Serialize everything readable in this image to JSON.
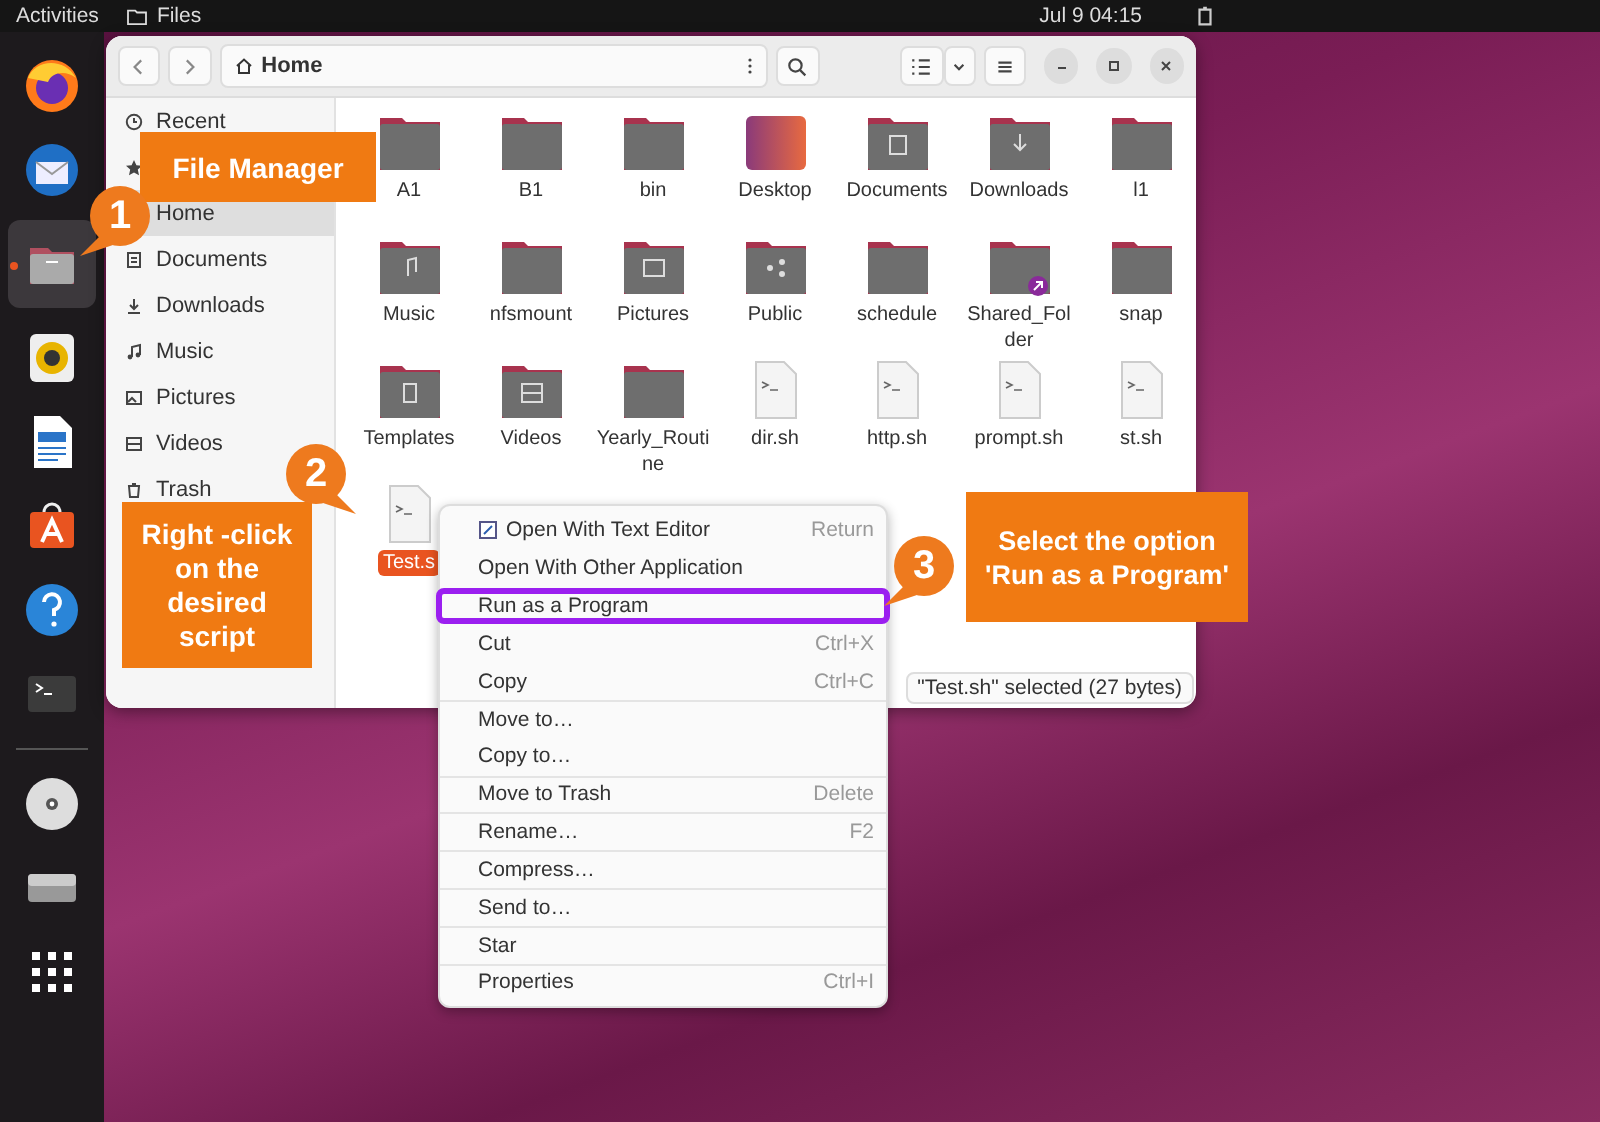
{
  "top_bar": {
    "activities": "Activities",
    "app_name": "Files",
    "clock": "Jul 9  04:15"
  },
  "dock": [
    {
      "kind": "firefox"
    },
    {
      "kind": "mail"
    },
    {
      "kind": "files",
      "running": true
    },
    {
      "kind": "speaker"
    },
    {
      "kind": "writer"
    },
    {
      "kind": "store"
    },
    {
      "kind": "help"
    },
    {
      "kind": "terminal"
    },
    {
      "kind": "separator"
    },
    {
      "kind": "disc"
    },
    {
      "kind": "drive"
    },
    {
      "kind": "grid"
    }
  ],
  "window": {
    "path": "Home",
    "sidebar": [
      {
        "kind": "recent",
        "label": "Recent",
        "selected": false
      },
      {
        "kind": "starred",
        "selected": false
      },
      {
        "kind": "home",
        "label": "Home",
        "selected": true
      },
      {
        "kind": "documents",
        "label": "Documents",
        "selected": false
      },
      {
        "kind": "downloads",
        "label": "Downloads",
        "selected": false
      },
      {
        "kind": "music",
        "label": "Music",
        "selected": false
      },
      {
        "kind": "pictures",
        "label": "Pictures",
        "selected": false
      },
      {
        "kind": "videos",
        "label": "Videos",
        "selected": false
      },
      {
        "kind": "trash",
        "label": "Trash",
        "selected": false
      }
    ],
    "files": [
      {
        "kind": "folder",
        "name": "A1",
        "selected": false
      },
      {
        "kind": "folder",
        "name": "B1",
        "selected": false
      },
      {
        "kind": "folder",
        "name": "bin",
        "selected": false
      },
      {
        "kind": "desktop",
        "name": "Desktop",
        "selected": false
      },
      {
        "kind": "documents",
        "name": "Documents",
        "selected": false
      },
      {
        "kind": "downloads",
        "name": "Downloads",
        "selected": false
      },
      {
        "kind": "folder",
        "name": "l1",
        "selected": false
      },
      {
        "kind": "music",
        "name": "Music",
        "selected": false
      },
      {
        "kind": "folder",
        "name": "nfsmount",
        "selected": false
      },
      {
        "kind": "pictures",
        "name": "Pictures",
        "selected": false
      },
      {
        "kind": "public",
        "name": "Public",
        "selected": false
      },
      {
        "kind": "folder",
        "name": "schedule",
        "selected": false
      },
      {
        "kind": "link",
        "name": "Shared_Folder",
        "selected": false
      },
      {
        "kind": "folder",
        "name": "snap",
        "selected": false
      },
      {
        "kind": "templates",
        "name": "Templates",
        "selected": false
      },
      {
        "kind": "videos",
        "name": "Videos",
        "selected": false
      },
      {
        "kind": "folder",
        "name": "Yearly_Routine",
        "selected": false
      },
      {
        "kind": "script",
        "name": "dir.sh",
        "selected": false
      },
      {
        "kind": "script",
        "name": "http.sh",
        "selected": false
      },
      {
        "kind": "script",
        "name": "prompt.sh",
        "selected": false
      },
      {
        "kind": "script",
        "name": "st.sh",
        "selected": false
      },
      {
        "kind": "script",
        "name": "Test.s",
        "selected": true
      }
    ],
    "status": "\"Test.sh\" selected (27 bytes)"
  },
  "context_menu": [
    {
      "label": "Open With Text Editor",
      "shortcut": "Return",
      "has_icon": true,
      "divider_above": false,
      "highlighted": false
    },
    {
      "label": "Open With Other Application",
      "has_icon": false,
      "divider_above": false,
      "highlighted": false
    },
    {
      "label": "Run as a Program",
      "has_icon": false,
      "divider_above": false,
      "highlighted": true
    },
    {
      "label": "Cut",
      "shortcut": "Ctrl+X",
      "has_icon": false,
      "divider_above": false,
      "highlighted": false
    },
    {
      "label": "Copy",
      "shortcut": "Ctrl+C",
      "has_icon": false,
      "divider_above": false,
      "highlighted": false
    },
    {
      "label": "Move to…",
      "has_icon": false,
      "divider_above": true,
      "highlighted": false
    },
    {
      "label": "Copy to…",
      "has_icon": false,
      "divider_above": false,
      "highlighted": false
    },
    {
      "label": "Move to Trash",
      "shortcut": "Delete",
      "has_icon": false,
      "divider_above": true,
      "highlighted": false
    },
    {
      "label": "Rename…",
      "shortcut": "F2",
      "has_icon": false,
      "divider_above": true,
      "highlighted": false
    },
    {
      "label": "Compress…",
      "has_icon": false,
      "divider_above": true,
      "highlighted": false
    },
    {
      "label": "Send to…",
      "has_icon": false,
      "divider_above": true,
      "highlighted": false
    },
    {
      "label": "Star",
      "has_icon": false,
      "divider_above": true,
      "highlighted": false
    },
    {
      "label": "Properties",
      "shortcut": "Ctrl+I",
      "has_icon": false,
      "divider_above": true,
      "highlighted": false
    }
  ],
  "annotations": [
    {
      "kind": "label",
      "text": "File Manager"
    },
    {
      "kind": "badge",
      "text": "1"
    },
    {
      "kind": "label",
      "text": "Right -click on the desired script"
    },
    {
      "kind": "badge",
      "text": "2"
    },
    {
      "kind": "badge",
      "text": "3"
    },
    {
      "kind": "label",
      "text": "Select the option 'Run as a Program'"
    }
  ]
}
